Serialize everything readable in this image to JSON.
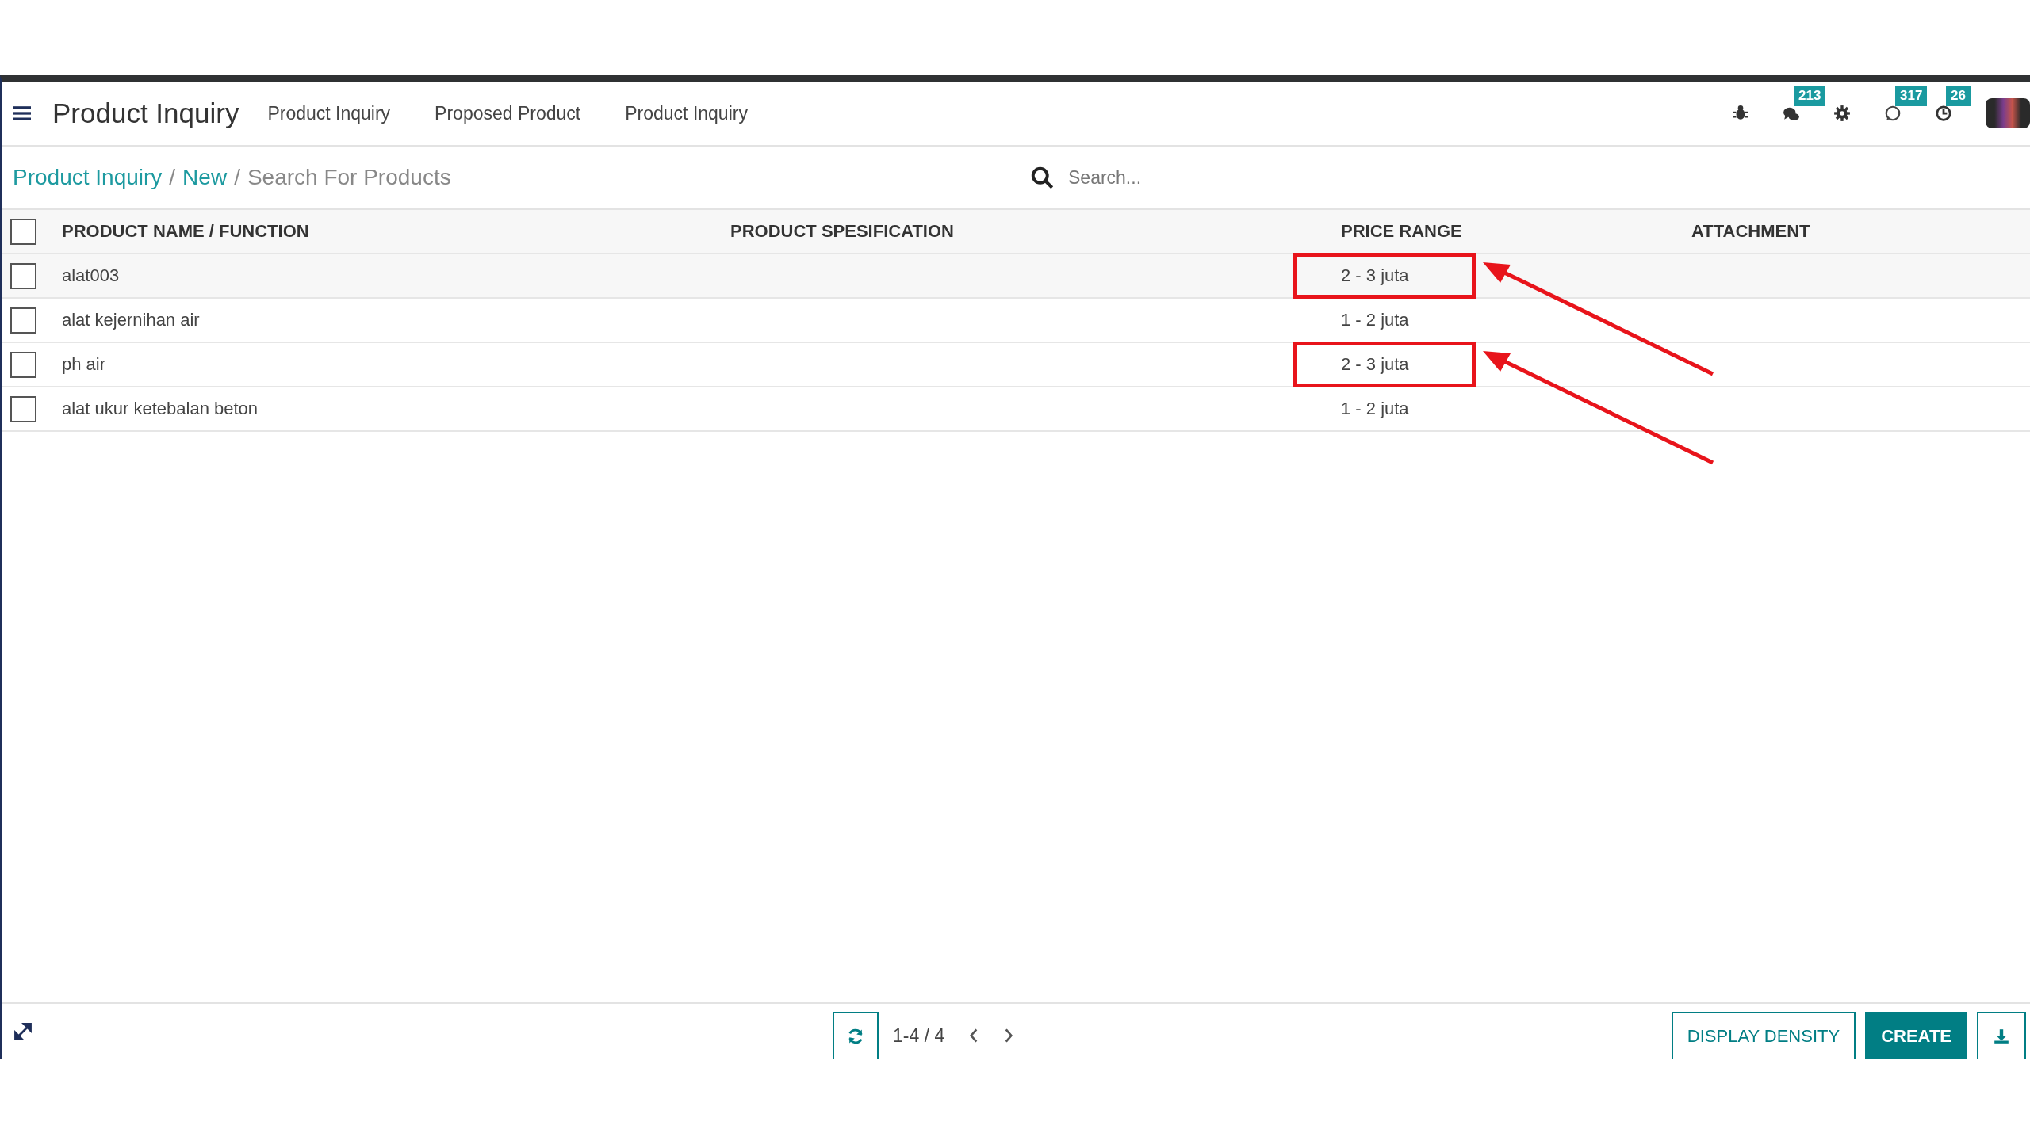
{
  "app_title": "Product Inquiry",
  "menu": [
    {
      "label": "Product Inquiry"
    },
    {
      "label": "Proposed Product"
    },
    {
      "label": "Product Inquiry"
    }
  ],
  "systray": [
    {
      "kind": "bug"
    },
    {
      "kind": "chat",
      "badge": "213"
    },
    {
      "kind": "gear"
    },
    {
      "kind": "whatsapp",
      "badge": "317"
    },
    {
      "kind": "clock",
      "badge": "26"
    },
    {
      "kind": "avatar"
    }
  ],
  "breadcrumb": [
    {
      "label": "Product Inquiry",
      "link": true
    },
    {
      "separator": "/",
      "label": "New",
      "link": true
    },
    {
      "separator": "/",
      "label": "Search For Products",
      "link": false
    }
  ],
  "search": {
    "placeholder": "Search..."
  },
  "table": {
    "all_checked": false,
    "columns": [
      "PRODUCT NAME / FUNCTION",
      "PRODUCT SPESIFICATION",
      "PRICE RANGE",
      "ATTACHMENT"
    ],
    "rows": [
      {
        "name": "alat003",
        "price": "2 - 3 juta",
        "checked": false,
        "highlighted": true
      },
      {
        "name": "alat kejernihan air",
        "price": "1 - 2 juta",
        "checked": false,
        "highlighted": false
      },
      {
        "name": "ph air",
        "price": "2 - 3 juta",
        "checked": false,
        "highlighted": true
      },
      {
        "name": "alat ukur ketebalan beton",
        "price": "1 - 2 juta",
        "checked": false,
        "highlighted": false
      }
    ]
  },
  "pager": "1-4 / 4",
  "buttons": [
    {
      "label": "DISPLAY DENSITY",
      "kind": "secondary"
    },
    {
      "label": "CREATE",
      "kind": "primary"
    }
  ]
}
